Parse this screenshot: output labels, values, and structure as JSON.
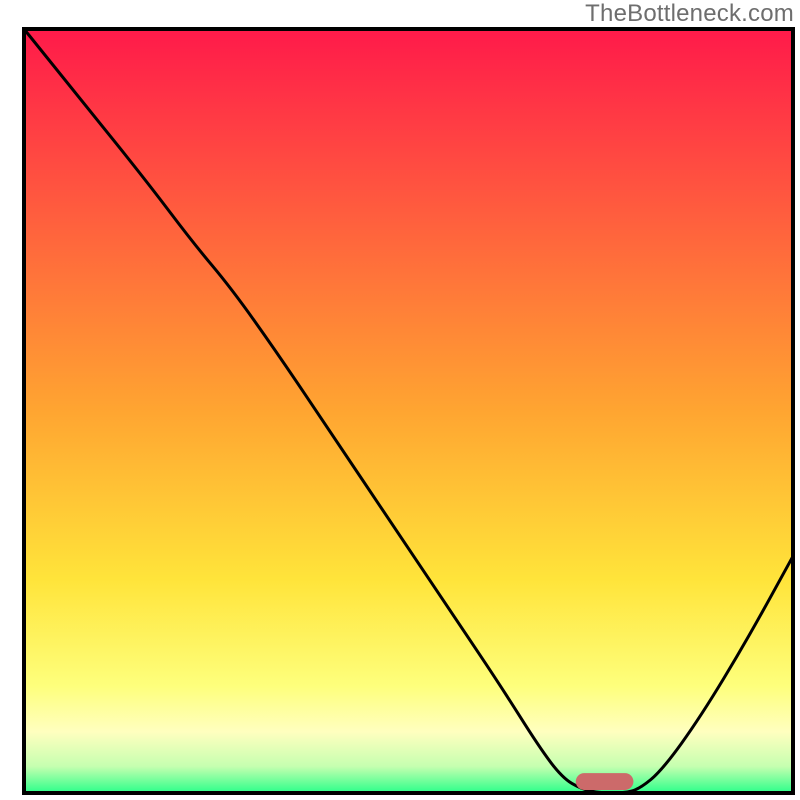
{
  "watermark": "TheBottleneck.com",
  "chart_data": {
    "type": "line",
    "title": "",
    "xlabel": "",
    "ylabel": "",
    "xlim": [
      0,
      100
    ],
    "ylim": [
      0,
      100
    ],
    "grid": false,
    "legend": false,
    "background_gradient": {
      "stops": [
        {
          "offset": 0.0,
          "color": "#ff1a4a"
        },
        {
          "offset": 0.5,
          "color": "#ffa531"
        },
        {
          "offset": 0.72,
          "color": "#ffe43a"
        },
        {
          "offset": 0.86,
          "color": "#feff7c"
        },
        {
          "offset": 0.92,
          "color": "#ffffbf"
        },
        {
          "offset": 0.965,
          "color": "#c6ffb0"
        },
        {
          "offset": 1.0,
          "color": "#2bff8a"
        }
      ]
    },
    "curve": {
      "description": "Bottleneck curve: steep fall from top-left, minimum plateau near x≈75, rise toward right edge.",
      "xy": [
        [
          0.0,
          100.0
        ],
        [
          8.0,
          90.0
        ],
        [
          16.0,
          80.0
        ],
        [
          22.0,
          72.0
        ],
        [
          27.0,
          66.0
        ],
        [
          33.0,
          57.5
        ],
        [
          40.0,
          47.0
        ],
        [
          48.0,
          35.0
        ],
        [
          56.0,
          23.0
        ],
        [
          62.0,
          14.0
        ],
        [
          67.0,
          6.0
        ],
        [
          70.0,
          2.0
        ],
        [
          72.5,
          0.5
        ],
        [
          75.0,
          0.0
        ],
        [
          78.0,
          0.0
        ],
        [
          80.0,
          0.5
        ],
        [
          83.0,
          3.0
        ],
        [
          88.0,
          10.0
        ],
        [
          94.0,
          20.0
        ],
        [
          100.0,
          31.0
        ]
      ]
    },
    "marker": {
      "x_center": 75.5,
      "y": 1.5,
      "color": "#cc6a6a",
      "width": 7.5,
      "height": 2.2,
      "shape": "rounded-bar"
    }
  }
}
